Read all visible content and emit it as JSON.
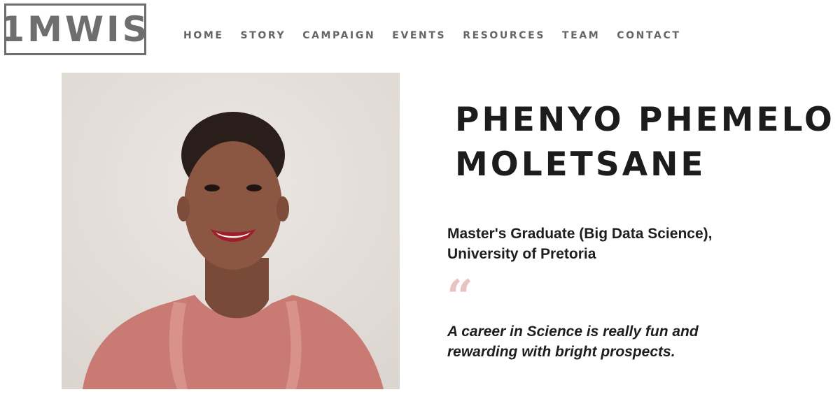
{
  "logo": {
    "text": "1MWIS"
  },
  "nav": {
    "items": [
      {
        "label": "HOME"
      },
      {
        "label": "STORY"
      },
      {
        "label": "CAMPAIGN"
      },
      {
        "label": "EVENTS"
      },
      {
        "label": "RESOURCES"
      },
      {
        "label": "TEAM"
      },
      {
        "label": "CONTACT"
      }
    ]
  },
  "profile": {
    "name_line1": "PHENYO PHEMELO",
    "name_line2": "MOLETSANE",
    "role_line1": "Master's Graduate (Big Data Science),",
    "role_line2": "University of Pretoria",
    "quote_mark": "“",
    "quote_line1": "A career in Science is really fun and",
    "quote_line2": "rewarding with bright prospects."
  },
  "colors": {
    "brand_gray": "#6e6e6e",
    "quote_accent": "#e8c3c5",
    "photo_background": "#e6e0db",
    "top_color": "#c97a72"
  }
}
